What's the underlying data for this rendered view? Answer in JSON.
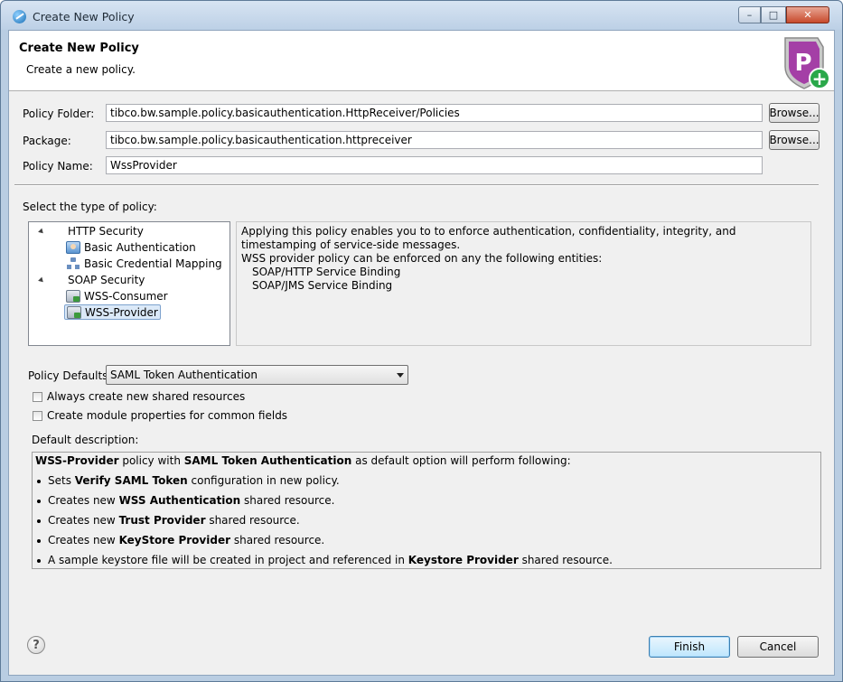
{
  "window": {
    "title": "Create New Policy",
    "minimize_glyph": "–",
    "maximize_glyph": "□",
    "close_glyph": "✕"
  },
  "header": {
    "title": "Create New Policy",
    "subtitle": "Create a new policy.",
    "badge_letter": "P",
    "badge_plus": "+"
  },
  "form": {
    "policy_folder": {
      "label": "Policy Folder:",
      "value": "tibco.bw.sample.policy.basicauthentication.HttpReceiver/Policies",
      "browse": "Browse..."
    },
    "package": {
      "label": "Package:",
      "value": "tibco.bw.sample.policy.basicauthentication.httpreceiver",
      "browse": "Browse..."
    },
    "policy_name": {
      "label": "Policy Name:",
      "value": "WssProvider"
    }
  },
  "policy_type": {
    "label": "Select the type of policy:",
    "tree": [
      {
        "label": "HTTP Security",
        "children": [
          {
            "label": "Basic Authentication",
            "icon": "user-shield-icon"
          },
          {
            "label": "Basic Credential Mapping",
            "icon": "credential-map-icon"
          }
        ]
      },
      {
        "label": "SOAP Security",
        "children": [
          {
            "label": "WSS-Consumer",
            "icon": "wss-icon"
          },
          {
            "label": "WSS-Provider",
            "icon": "wss-icon",
            "selected": true
          }
        ]
      }
    ],
    "description": {
      "line1": "Applying this policy enables you to to enforce authentication, confidentiality, integrity, and timestamping of service-side messages.",
      "line2": "WSS provider policy can be enforced on any the following entities:",
      "entities": [
        "SOAP/HTTP Service Binding",
        "SOAP/JMS Service Binding"
      ]
    }
  },
  "defaults": {
    "label": "Policy Defaults:",
    "selected": "SAML Token Authentication",
    "check_shared": "Always create new shared resources",
    "check_module": "Create module properties for common fields",
    "desc_label": "Default description:",
    "summary": {
      "b1": "WSS-Provider",
      "t1": " policy with ",
      "b2": "SAML Token Authentication",
      "t2": " as default option will perform following:"
    },
    "bullets": [
      {
        "pre": "Sets ",
        "bold": "Verify SAML Token",
        "post": " configuration in new policy."
      },
      {
        "pre": "Creates new ",
        "bold": "WSS Authentication",
        "post": " shared resource."
      },
      {
        "pre": "Creates new ",
        "bold": "Trust Provider",
        "post": " shared resource."
      },
      {
        "pre": "Creates new ",
        "bold": "KeyStore Provider",
        "post": " shared resource."
      },
      {
        "pre": "A sample keystore file will be created in project and referenced in ",
        "bold": "Keystore Provider",
        "post": " shared resource."
      }
    ]
  },
  "footer": {
    "help": "?",
    "finish": "Finish",
    "cancel": "Cancel"
  },
  "colors": {
    "badge": "#a43fa6",
    "badge_plus": "#2aa84a",
    "selection": "#dbe9f8"
  }
}
